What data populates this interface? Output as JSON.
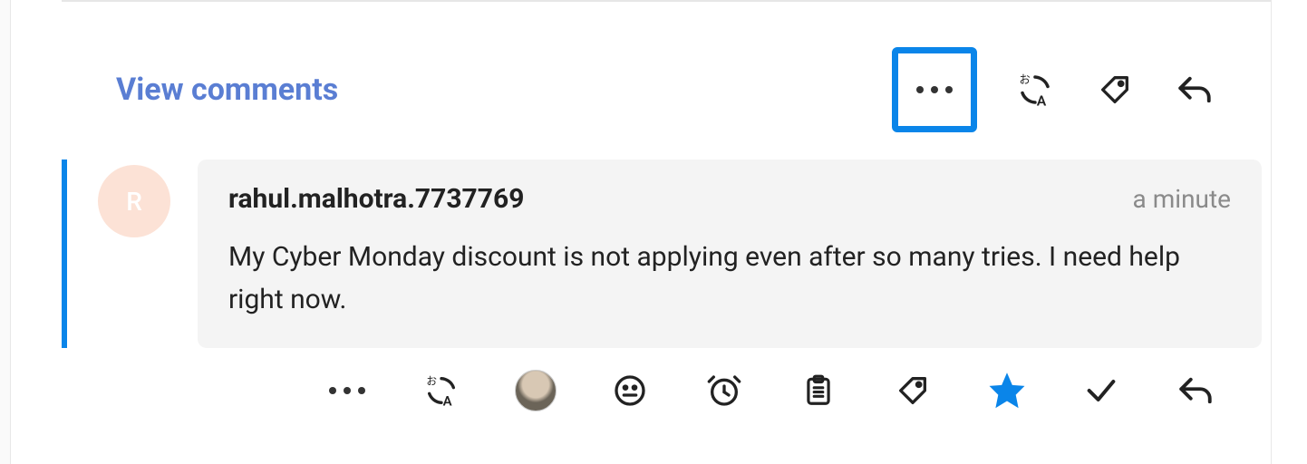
{
  "header": {
    "view_comments_label": "View comments"
  },
  "comment": {
    "avatar_initial": "R",
    "username": "rahul.malhotra.7737769",
    "timestamp": "a minute",
    "message": "My Cyber Monday discount is not applying even after so many tries. I need help right now."
  }
}
